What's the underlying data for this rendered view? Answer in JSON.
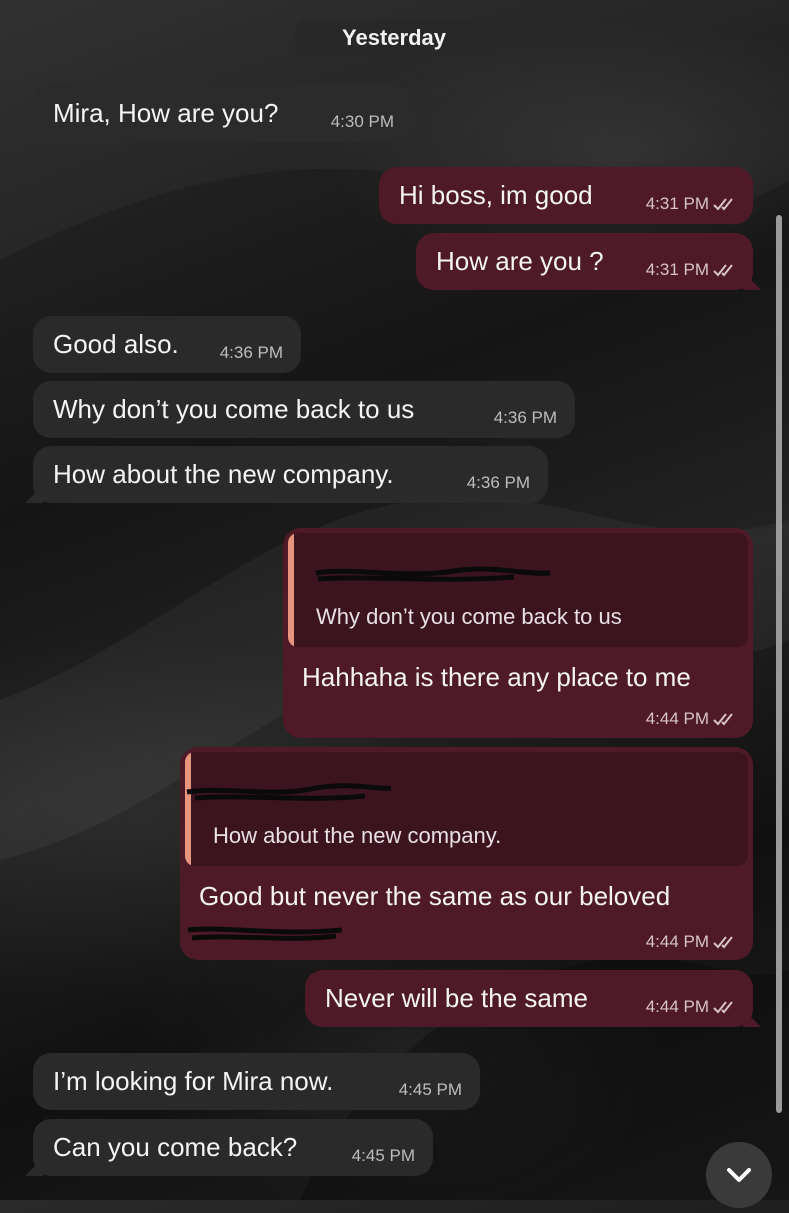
{
  "date_separator": "Yesterday",
  "messages": [
    {
      "direction": "in",
      "text": "Mira, How are you?",
      "time": "4:30 PM"
    },
    {
      "direction": "out",
      "text": "Hi boss, im good",
      "time": "4:31 PM",
      "status_icon": "double-check-icon"
    },
    {
      "direction": "out",
      "text": "How are you ?",
      "time": "4:31 PM",
      "status_icon": "double-check-icon"
    },
    {
      "direction": "in",
      "text": "Good also.",
      "time": "4:36 PM"
    },
    {
      "direction": "in",
      "text": "Why don’t you come back to us",
      "time": "4:36 PM"
    },
    {
      "direction": "in",
      "text": "How about the new company.",
      "time": "4:36 PM"
    },
    {
      "direction": "out",
      "reply_quote": "Why don’t you come back to us",
      "text": "Hahhaha is there any place to me",
      "time": "4:44 PM",
      "status_icon": "double-check-icon"
    },
    {
      "direction": "out",
      "reply_quote": "How about the new company.",
      "text": "Good but never the same as our beloved",
      "time": "4:44 PM",
      "status_icon": "double-check-icon"
    },
    {
      "direction": "out",
      "text": "Never will be the same",
      "time": "4:44 PM",
      "status_icon": "double-check-icon"
    },
    {
      "direction": "in",
      "text": "I’m looking for Mira now.",
      "time": "4:45 PM"
    },
    {
      "direction": "in",
      "text": "Can you come back?",
      "time": "4:45 PM"
    }
  ],
  "controls": {
    "scroll_down_icon": "chevron-down-icon"
  },
  "colors": {
    "outgoing_bubble": "#4f1a27",
    "incoming_bubble": "#2c2c2c",
    "reply_accent": "#e8957f"
  }
}
